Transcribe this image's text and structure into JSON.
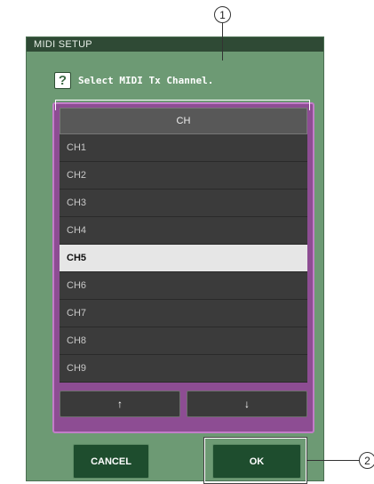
{
  "dialog": {
    "title": "MIDI SETUP",
    "prompt": "Select MIDI Tx Channel.",
    "help_icon": "?"
  },
  "list": {
    "header": "CH",
    "rows": [
      "CH1",
      "CH2",
      "CH3",
      "CH4",
      "CH5",
      "CH6",
      "CH7",
      "CH8",
      "CH9"
    ],
    "selected": "CH5"
  },
  "arrows": {
    "up": "↑",
    "down": "↓"
  },
  "buttons": {
    "cancel": "CANCEL",
    "ok": "OK"
  },
  "callouts": {
    "one": "1",
    "two": "2"
  },
  "colors": {
    "panel": "#6d9a74",
    "frame": "#8d4d93",
    "button": "#1e4d2e"
  }
}
